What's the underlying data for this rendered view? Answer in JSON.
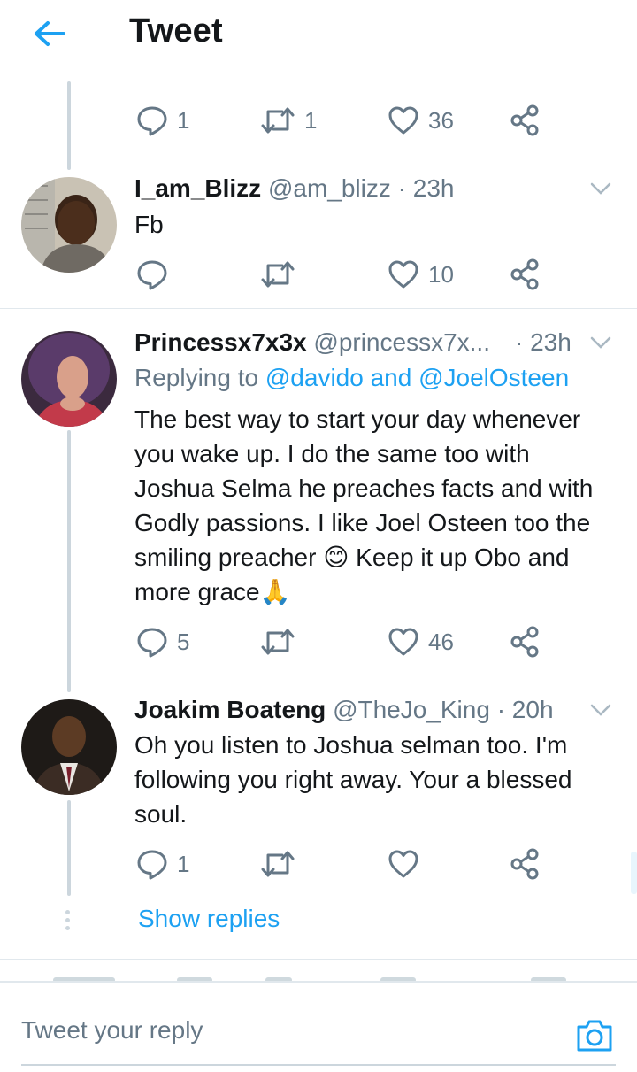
{
  "header": {
    "title": "Tweet",
    "back_icon": "arrow-left-icon",
    "accent": "#1da1f2"
  },
  "top_actions": {
    "replies": "1",
    "retweets": "1",
    "likes": "36"
  },
  "tweets": [
    {
      "name": "I_am_Blizz",
      "handle": "@am_blizz · 23h",
      "text": "Fb",
      "replies": "",
      "retweets": "",
      "likes": "10"
    },
    {
      "name": "Princessx7x3x",
      "handle": "@princessx7x...",
      "time": "· 23h",
      "replying_prefix": "Replying to",
      "replying_mentions": "@davido and @JoelOsteen",
      "text": "The best way to start your day whenever you wake up. I do the same too with Joshua Selma he preaches facts and with Godly passions. I like Joel Osteen too the smiling preacher 😊 Keep it up Obo and more grace🙏",
      "replies": "5",
      "retweets": "",
      "likes": "46"
    },
    {
      "name": "Joakim Boateng",
      "handle": "@TheJo_King · 20h",
      "text": "Oh you listen to Joshua selman too. I'm following you right away. Your a blessed soul.",
      "replies": "1",
      "retweets": "",
      "likes": ""
    }
  ],
  "show_replies": "Show replies",
  "reply_bar": {
    "placeholder": "Tweet your reply",
    "camera_icon": "camera-icon"
  }
}
